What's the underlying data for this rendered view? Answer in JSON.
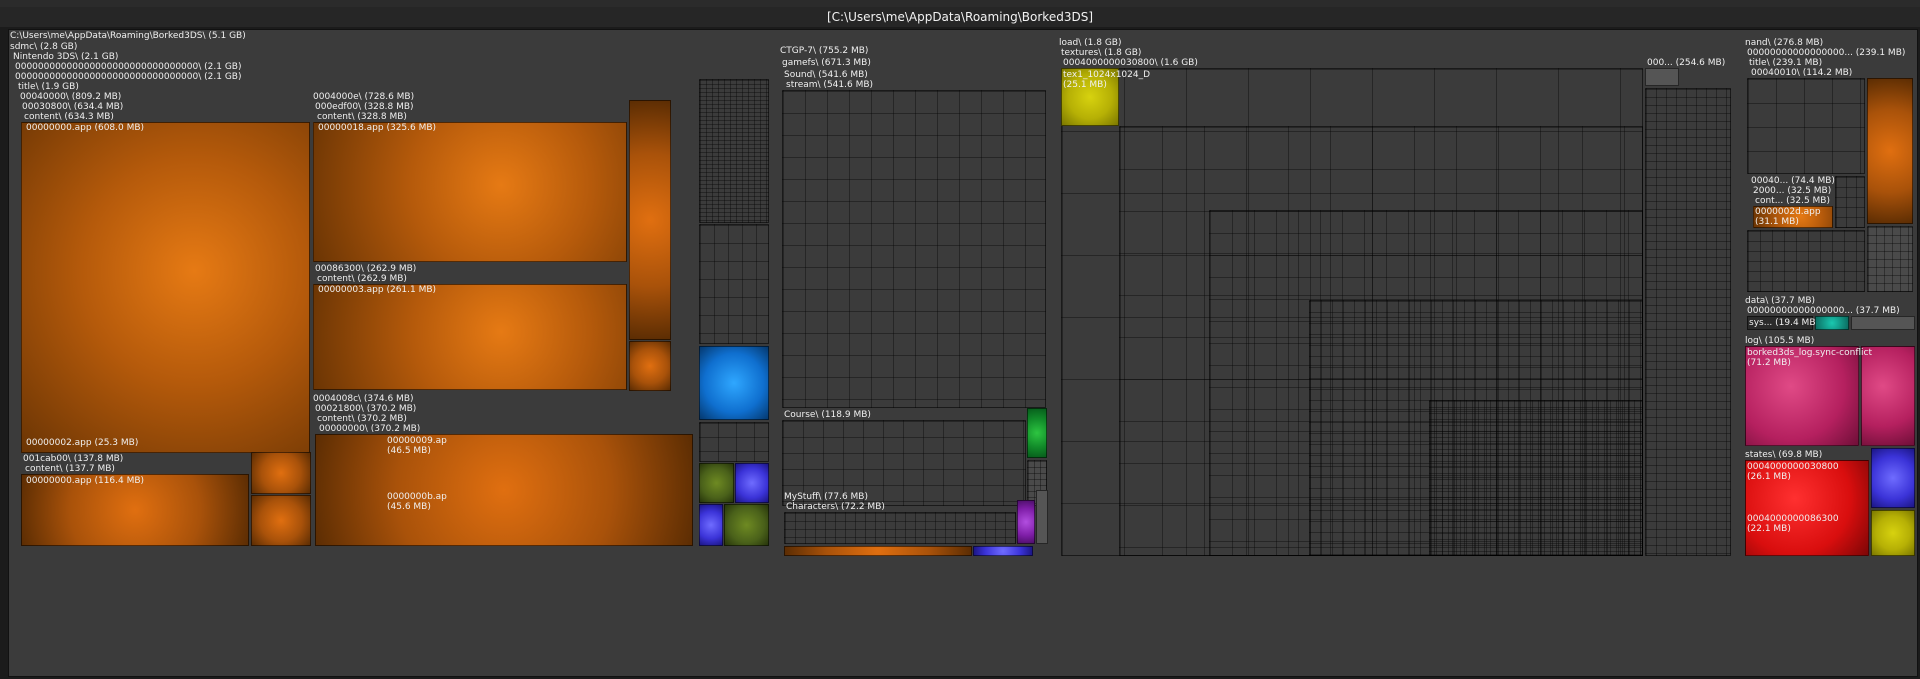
{
  "window": {
    "title": "[C:\\Users\\me\\AppData\\Roaming\\Borked3DS]"
  },
  "colors": {
    "orange": "#d46e10",
    "green": "#12902b",
    "yellow": "#c4be07",
    "purple": "#8a24b5",
    "magenta": "#c11a95",
    "pink": "#c0286a",
    "red": "#e01212",
    "blue": "#4a43e6",
    "cyan": "#1680e0"
  },
  "tree": {
    "root": "C:\\Users\\me\\AppData\\Roaming\\Borked3DS\\ (5.1 GB)",
    "sdmc": "sdmc\\ (2.8 GB)",
    "nintendo": "Nintendo 3DS\\ (2.1 GB)",
    "id1": "00000000000000000000000000000000\\ (2.1 GB)",
    "id2": "00000000000000000000000000000000\\ (2.1 GB)",
    "title": "title\\ (1.9 GB)",
    "t00040000": "00040000\\ (809.2 MB)",
    "t00030800": "00030800\\ (634.4 MB)",
    "content1": "content\\ (634.3 MB)",
    "app00000000": "00000000.app (608.0 MB)",
    "app00000002": "00000002.app (25.3 MB)",
    "t001cab00": "001cab00\\ (137.8 MB)",
    "content2": "content\\ (137.7 MB)",
    "app00000000b": "00000000.app (116.4 MB)",
    "t0004000e": "0004000e\\ (728.6 MB)",
    "t000edf00": "000edf00\\ (328.8 MB)",
    "content3": "content\\ (328.8 MB)",
    "app00000018": "00000018.app (325.6 MB)",
    "t00086300": "00086300\\ (262.9 MB)",
    "content4": "content\\ (262.9 MB)",
    "app00000003": "00000003.app (261.1 MB)",
    "t0004008c": "0004008c\\ (374.6 MB)",
    "t00021800": "00021800\\ (370.2 MB)",
    "content5": "content\\ (370.2 MB)",
    "t00000000": "00000000\\ (370.2 MB)",
    "app00000009": "00000009.app (46.5 MB)",
    "app0000000b": "0000000b.app (45.6 MB)",
    "ctgp": "CTGP-7\\ (755.2 MB)",
    "gamefs": "gamefs\\ (671.3 MB)",
    "sound": "Sound\\ (541.6 MB)",
    "stream": "stream\\ (541.6 MB)",
    "course": "Course\\ (118.9 MB)",
    "mystuff": "MyStuff\\ (77.6 MB)",
    "characters": "Characters\\ (72.2 MB)",
    "load": "load\\ (1.8 GB)",
    "textures": "textures\\ (1.8 GB)",
    "tex_id": "0004000000030800\\ (1.6 GB)",
    "tex1": "tex1_1024x1024_D",
    "tex1_size": "(25.1 MB)",
    "tex_other": "000... (254.6 MB)",
    "nand": "nand\\ (276.8 MB)",
    "nand_id": "00000000000000000... (239.1 MB)",
    "nand_title": "title\\ (239.1 MB)",
    "nand_00040010": "00040010\\ (114.2 MB)",
    "nand_00040": "00040... (74.4 MB)",
    "nand_2000": "2000... (32.5 MB)",
    "nand_cont": "cont... (32.5 MB)",
    "nand_app2d": "0000002d.app",
    "nand_app2d_size": "(31.1 MB)",
    "data": "data\\ (37.7 MB)",
    "data_id": "00000000000000000... (37.7 MB)",
    "sys": "sys... (19.4 MB)",
    "log": "log\\ (105.5 MB)",
    "logfile": "borked3ds_log.sync-conflict",
    "logfile_size": "(71.2 MB)",
    "states": "states\\ (69.8 MB)",
    "state1": "0004000000030800",
    "state1_size": "(26.1 MB)",
    "state2": "0004000000086300",
    "state2_size": "(22.1 MB)"
  }
}
